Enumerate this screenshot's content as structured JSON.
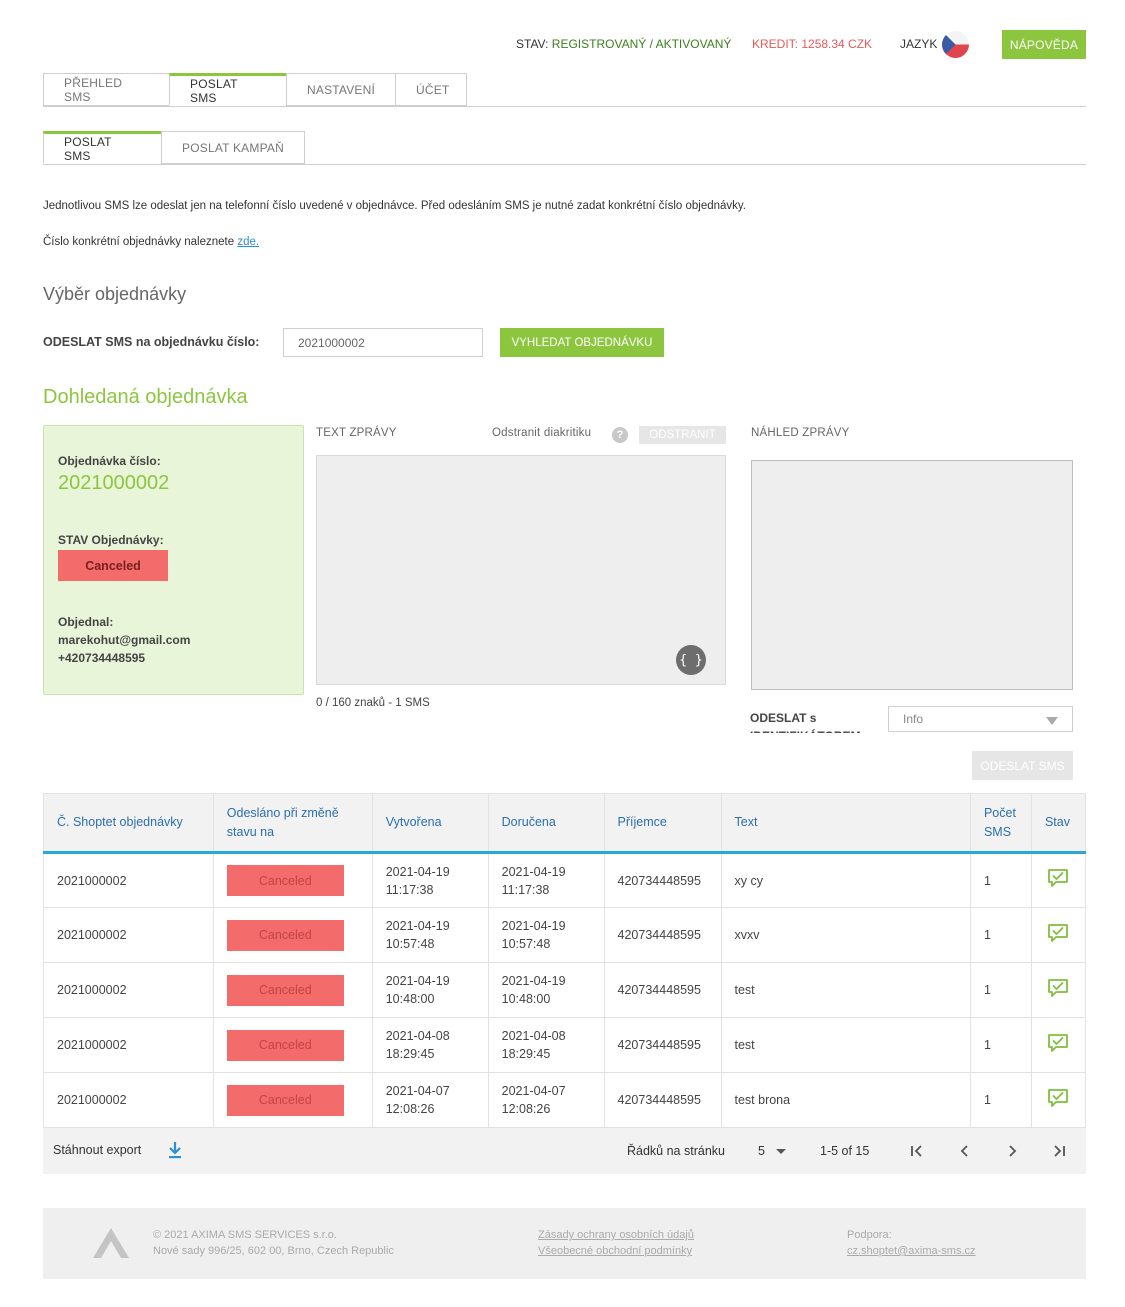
{
  "header": {
    "status_label": "STAV:",
    "status_value": "REGISTROVANÝ / AKTIVOVANÝ",
    "credit": "KREDIT: 1258.34 CZK",
    "language_label": "JAZYK",
    "language_flag": "czech-flag",
    "help_label": "NÁPOVĚDA"
  },
  "main_tabs": [
    "PŘEHLED SMS",
    "POSLAT SMS",
    "NASTAVENÍ",
    "ÚČET"
  ],
  "sub_tabs": [
    "POSLAT SMS",
    "POSLAT KAMPAŇ"
  ],
  "info": {
    "line1": "Jednotlivou SMS lze odeslat jen na telefonní číslo uvedené v objednávce. Před odesláním SMS je nutné zadat konkrétní číslo objednávky.",
    "line2_text": "Číslo konkrétní objednávky naleznete ",
    "line2_link": "zde."
  },
  "selection": {
    "title": "Výběr objednávky",
    "label": "ODESLAT SMS na objednávku číslo:",
    "input_value": "2021000002",
    "button": "VYHLEDAT OBJEDNÁVKU"
  },
  "found": {
    "title": "Dohledaná objednávka",
    "order_label": "Objednávka číslo:",
    "order_number": "2021000002",
    "state_label": "STAV Objednávky:",
    "state_value": "Canceled",
    "ordered_by_label": "Objednal:",
    "email": "marekohut@gmail.com",
    "phone": "+420734448595"
  },
  "message": {
    "text_label": "TEXT ZPRÁVY",
    "diacritics_label": "Odstranit diakritiku",
    "remove_button": "ODSTRANIT",
    "preview_label": "NÁHLED ZPRÁVY",
    "counter": "0 / 160 znaků - 1 SMS",
    "sender_label": "ODESLAT s IDENTIFIKÁTOREM:",
    "sender_value": "Info",
    "send_button": "ODESLAT SMS",
    "placeholder_icon": "braces-icon"
  },
  "table": {
    "headers": [
      "Č. Shoptet objednávky",
      "Odesláno při změně stavu na",
      "Vytvořena",
      "Doručena",
      "Příjemce",
      "Text",
      "Počet SMS",
      "Stav"
    ],
    "rows": [
      {
        "order": "2021000002",
        "status": "Canceled",
        "created_date": "2021-04-19",
        "created_time": "11:17:38",
        "delivered_date": "2021-04-19",
        "delivered_time": "11:17:38",
        "recipient": "420734448595",
        "text": "xy cy",
        "count": "1"
      },
      {
        "order": "2021000002",
        "status": "Canceled",
        "created_date": "2021-04-19",
        "created_time": "10:57:48",
        "delivered_date": "2021-04-19",
        "delivered_time": "10:57:48",
        "recipient": "420734448595",
        "text": "xvxv",
        "count": "1"
      },
      {
        "order": "2021000002",
        "status": "Canceled",
        "created_date": "2021-04-19",
        "created_time": "10:48:00",
        "delivered_date": "2021-04-19",
        "delivered_time": "10:48:00",
        "recipient": "420734448595",
        "text": "test",
        "count": "1"
      },
      {
        "order": "2021000002",
        "status": "Canceled",
        "created_date": "2021-04-08",
        "created_time": "18:29:45",
        "delivered_date": "2021-04-08",
        "delivered_time": "18:29:45",
        "recipient": "420734448595",
        "text": "test",
        "count": "1"
      },
      {
        "order": "2021000002",
        "status": "Canceled",
        "created_date": "2021-04-07",
        "created_time": "12:08:26",
        "delivered_date": "2021-04-07",
        "delivered_time": "12:08:26",
        "recipient": "420734448595",
        "text": "test brona",
        "count": "1"
      }
    ],
    "state_icon": "message-check-icon",
    "export_label": "Stáhnout export",
    "rows_per_page_label": "Řádků na stránku",
    "rows_per_page_value": "5",
    "range": "1-5 of 15"
  },
  "footer": {
    "copyright": "© 2021 AXIMA SMS SERVICES s.r.o.",
    "address": "Nové sady 996/25, 602 00, Brno, Czech Republic",
    "privacy_link": "Zásady ochrany osobních údajů",
    "terms_link": "Všeobecné obchodní podmínky",
    "support_label": "Podpora:",
    "support_email": "cz.shoptet@axima-sms.cz"
  },
  "colors": {
    "accent_green": "#8cc63f",
    "status_green": "#3d7e1d",
    "credit_red": "#e35a5a",
    "badge_red": "#f46b6b",
    "table_header_blue": "#2b6fae",
    "table_header_line": "#2ba6d9"
  }
}
